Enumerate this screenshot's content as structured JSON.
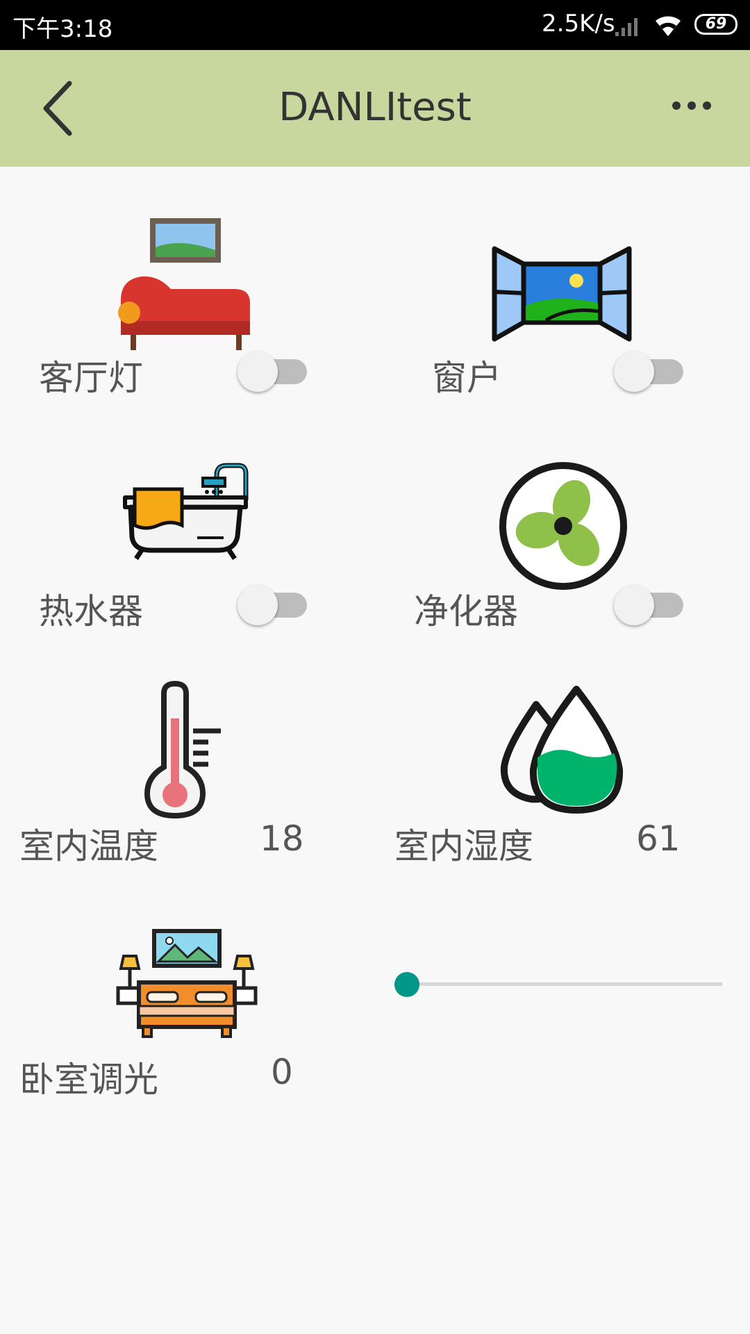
{
  "status_bar": {
    "time": "下午3:18",
    "network_speed": "2.5K/s",
    "battery": "69"
  },
  "app_bar": {
    "title": "DANLItest",
    "back_icon": "chevron-left-icon",
    "more_icon": "more-horizontal-icon"
  },
  "devices": [
    {
      "label": "客厅灯",
      "icon": "sofa-icon",
      "control": "switch",
      "on": false
    },
    {
      "label": "窗户",
      "icon": "window-icon",
      "control": "switch",
      "on": false
    },
    {
      "label": "热水器",
      "icon": "bathtub-icon",
      "control": "switch",
      "on": false
    },
    {
      "label": "净化器",
      "icon": "fan-icon",
      "control": "switch",
      "on": false
    },
    {
      "label": "室内温度",
      "icon": "thermometer-icon",
      "value": "18"
    },
    {
      "label": "室内湿度",
      "icon": "humidity-drop-icon",
      "value": "61"
    },
    {
      "label": "卧室调光",
      "icon": "bedroom-icon",
      "value": "0",
      "slider_level": 0
    }
  ],
  "colors": {
    "app_bar_bg": "#c8d79e",
    "slider_accent": "#009688",
    "switch_off_track": "#bdbdbd"
  }
}
